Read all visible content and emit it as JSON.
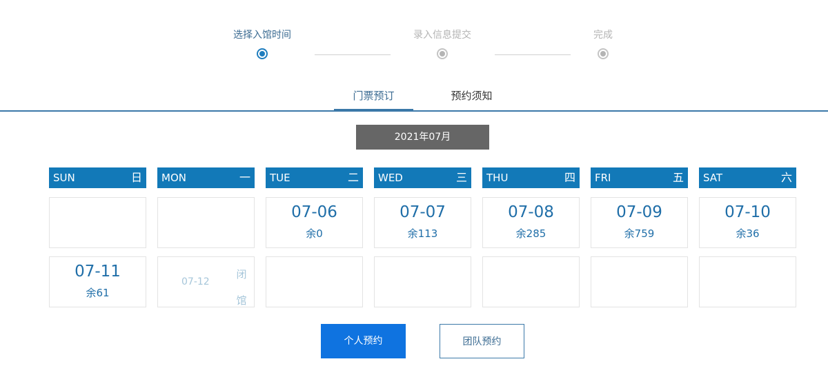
{
  "steps": [
    {
      "label": "选择入馆时间",
      "state": "active"
    },
    {
      "label": "录入信息提交",
      "state": "pending"
    },
    {
      "label": "完成",
      "state": "pending"
    }
  ],
  "tabs": [
    {
      "label": "门票预订",
      "active": true
    },
    {
      "label": "预约须知",
      "active": false
    }
  ],
  "month": "2021年07月",
  "weekdays": [
    {
      "en": "SUN",
      "zh": "日"
    },
    {
      "en": "MON",
      "zh": "一"
    },
    {
      "en": "TUE",
      "zh": "二"
    },
    {
      "en": "WED",
      "zh": "三"
    },
    {
      "en": "THU",
      "zh": "四"
    },
    {
      "en": "FRI",
      "zh": "五"
    },
    {
      "en": "SAT",
      "zh": "六"
    }
  ],
  "calendar": {
    "week1": [
      {
        "type": "empty"
      },
      {
        "type": "empty"
      },
      {
        "type": "available",
        "date": "07-06",
        "remain": "余0"
      },
      {
        "type": "available",
        "date": "07-07",
        "remain": "余113"
      },
      {
        "type": "available",
        "date": "07-08",
        "remain": "余285"
      },
      {
        "type": "available",
        "date": "07-09",
        "remain": "余759"
      },
      {
        "type": "available",
        "date": "07-10",
        "remain": "余36"
      }
    ],
    "week2": [
      {
        "type": "available",
        "date": "07-11",
        "remain": "余61"
      },
      {
        "type": "closed",
        "date": "07-12",
        "status": "闭馆"
      },
      {
        "type": "empty"
      },
      {
        "type": "empty"
      },
      {
        "type": "empty"
      },
      {
        "type": "empty"
      },
      {
        "type": "empty"
      }
    ]
  },
  "buttons": {
    "individual": "个人预约",
    "group": "团队预约"
  },
  "colors": {
    "accent": "#1279b8",
    "primary_button": "#0f73e0",
    "month_bg": "#666666"
  }
}
